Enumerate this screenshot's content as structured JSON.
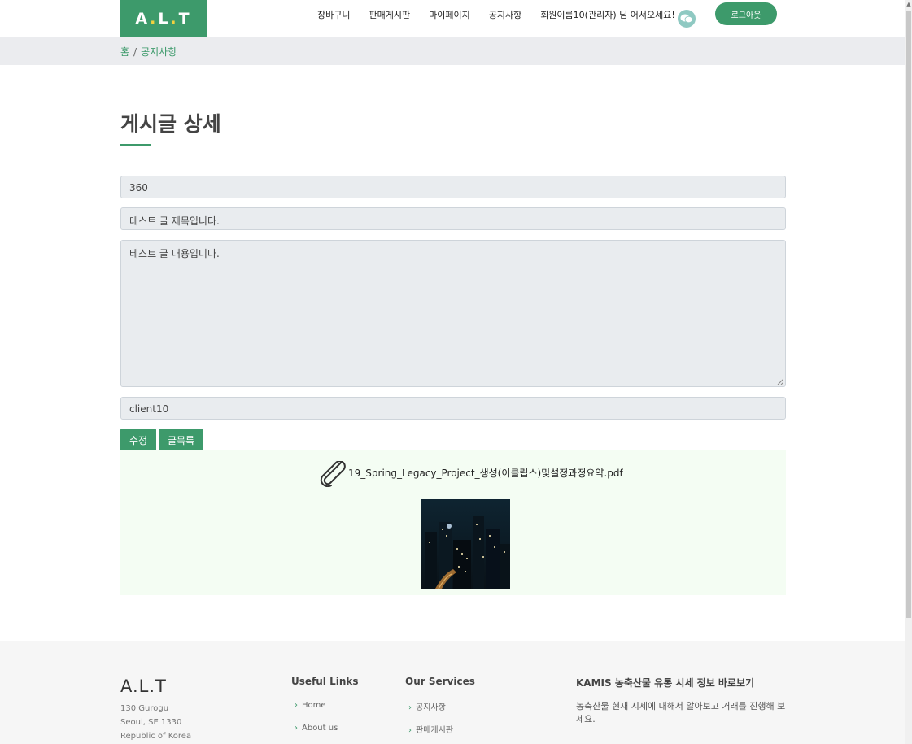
{
  "header": {
    "logo": {
      "part1": "A",
      "dot1": ".",
      "part2": "L",
      "dot2": ".",
      "part3": "T"
    },
    "nav": [
      "장바구니",
      "판매게시판",
      "마이페이지",
      "공지사항",
      "회원이름10(관리자) 님 어서오세요!"
    ],
    "logout_label": "로그아웃"
  },
  "breadcrumb": {
    "home": "홈",
    "separator": "/",
    "current": "공지사항"
  },
  "page": {
    "title": "게시글 상세"
  },
  "form": {
    "number": "360",
    "subject": "테스트 글 제목입니다.",
    "content": "테스트 글 내용입니다.",
    "writer": "client10"
  },
  "buttons": {
    "edit": "수정",
    "list": "글목록"
  },
  "attachment": {
    "filename": "19_Spring_Legacy_Project_생성(이클립스)및설정과정요약.pdf"
  },
  "footer": {
    "brand": "A.L.T",
    "address": [
      "130 Gurogu",
      "Seoul, SE 1330",
      "Republic of Korea"
    ],
    "useful_links": {
      "title": "Useful Links",
      "items": [
        "Home",
        "About us"
      ]
    },
    "services": {
      "title": "Our Services",
      "items": [
        "공지사항",
        "판매게시판"
      ]
    },
    "kamis": {
      "title": "KAMIS 농축산물 유통 시세 정보 바로보기",
      "description": "농축산물 현재 시세에 대해서 알아보고 거래를 진행해 보세요."
    }
  },
  "colors": {
    "brand": "#3d9a6b",
    "logo_dot": "#f3d13f",
    "attachment_bg": "#f4fdf3",
    "field_bg": "#e9ecef"
  },
  "icons": {
    "chat": "chat-bubble-icon",
    "attachment": "paperclip-icon",
    "link_chevron": "chevron-right-icon"
  }
}
